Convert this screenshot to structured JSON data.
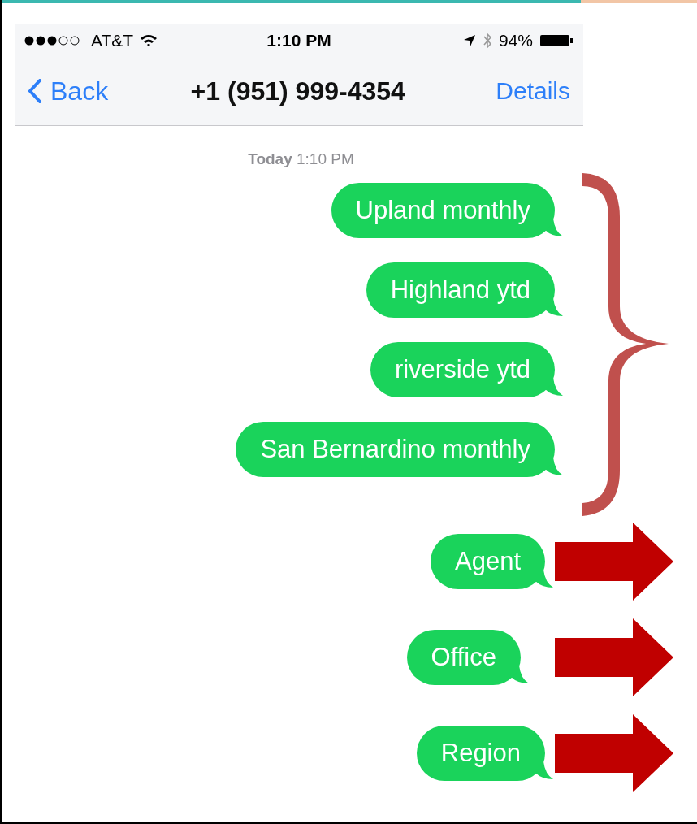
{
  "status_bar": {
    "carrier": "AT&T",
    "time": "1:10 PM",
    "battery": "94%"
  },
  "nav_bar": {
    "back": "Back",
    "title": "+1 (951) 999-4354",
    "action": "Details"
  },
  "timestamp": "**Today** 1:10 PM",
  "groups": [
    {
      "kind": "brace",
      "messages": [
        "Upland monthly",
        "Highland ytd",
        "riverside ytd",
        "San Bernardino monthly"
      ]
    },
    {
      "kind": "arrows",
      "messages": [
        "Agent",
        "Office",
        "Region"
      ]
    }
  ]
}
